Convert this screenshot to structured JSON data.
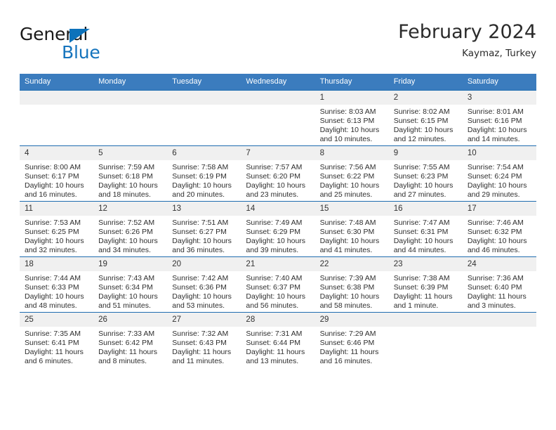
{
  "brand": {
    "name_dark": "General",
    "name_blue": "Blue",
    "accent_color": "#1574bd"
  },
  "header": {
    "title": "February 2024",
    "location": "Kaymaz, Turkey"
  },
  "theme": {
    "header_row_bg": "#3b7cbe",
    "cell_top_border": "#1f6cb0",
    "daynum_bg": "#f0f0f0"
  },
  "calendar": {
    "weekday_headers": [
      "Sunday",
      "Monday",
      "Tuesday",
      "Wednesday",
      "Thursday",
      "Friday",
      "Saturday"
    ],
    "weeks": [
      [
        {
          "day": "",
          "lines": []
        },
        {
          "day": "",
          "lines": []
        },
        {
          "day": "",
          "lines": []
        },
        {
          "day": "",
          "lines": []
        },
        {
          "day": "1",
          "lines": [
            "Sunrise: 8:03 AM",
            "Sunset: 6:13 PM",
            "Daylight: 10 hours",
            "and 10 minutes."
          ]
        },
        {
          "day": "2",
          "lines": [
            "Sunrise: 8:02 AM",
            "Sunset: 6:15 PM",
            "Daylight: 10 hours",
            "and 12 minutes."
          ]
        },
        {
          "day": "3",
          "lines": [
            "Sunrise: 8:01 AM",
            "Sunset: 6:16 PM",
            "Daylight: 10 hours",
            "and 14 minutes."
          ]
        }
      ],
      [
        {
          "day": "4",
          "lines": [
            "Sunrise: 8:00 AM",
            "Sunset: 6:17 PM",
            "Daylight: 10 hours",
            "and 16 minutes."
          ]
        },
        {
          "day": "5",
          "lines": [
            "Sunrise: 7:59 AM",
            "Sunset: 6:18 PM",
            "Daylight: 10 hours",
            "and 18 minutes."
          ]
        },
        {
          "day": "6",
          "lines": [
            "Sunrise: 7:58 AM",
            "Sunset: 6:19 PM",
            "Daylight: 10 hours",
            "and 20 minutes."
          ]
        },
        {
          "day": "7",
          "lines": [
            "Sunrise: 7:57 AM",
            "Sunset: 6:20 PM",
            "Daylight: 10 hours",
            "and 23 minutes."
          ]
        },
        {
          "day": "8",
          "lines": [
            "Sunrise: 7:56 AM",
            "Sunset: 6:22 PM",
            "Daylight: 10 hours",
            "and 25 minutes."
          ]
        },
        {
          "day": "9",
          "lines": [
            "Sunrise: 7:55 AM",
            "Sunset: 6:23 PM",
            "Daylight: 10 hours",
            "and 27 minutes."
          ]
        },
        {
          "day": "10",
          "lines": [
            "Sunrise: 7:54 AM",
            "Sunset: 6:24 PM",
            "Daylight: 10 hours",
            "and 29 minutes."
          ]
        }
      ],
      [
        {
          "day": "11",
          "lines": [
            "Sunrise: 7:53 AM",
            "Sunset: 6:25 PM",
            "Daylight: 10 hours",
            "and 32 minutes."
          ]
        },
        {
          "day": "12",
          "lines": [
            "Sunrise: 7:52 AM",
            "Sunset: 6:26 PM",
            "Daylight: 10 hours",
            "and 34 minutes."
          ]
        },
        {
          "day": "13",
          "lines": [
            "Sunrise: 7:51 AM",
            "Sunset: 6:27 PM",
            "Daylight: 10 hours",
            "and 36 minutes."
          ]
        },
        {
          "day": "14",
          "lines": [
            "Sunrise: 7:49 AM",
            "Sunset: 6:29 PM",
            "Daylight: 10 hours",
            "and 39 minutes."
          ]
        },
        {
          "day": "15",
          "lines": [
            "Sunrise: 7:48 AM",
            "Sunset: 6:30 PM",
            "Daylight: 10 hours",
            "and 41 minutes."
          ]
        },
        {
          "day": "16",
          "lines": [
            "Sunrise: 7:47 AM",
            "Sunset: 6:31 PM",
            "Daylight: 10 hours",
            "and 44 minutes."
          ]
        },
        {
          "day": "17",
          "lines": [
            "Sunrise: 7:46 AM",
            "Sunset: 6:32 PM",
            "Daylight: 10 hours",
            "and 46 minutes."
          ]
        }
      ],
      [
        {
          "day": "18",
          "lines": [
            "Sunrise: 7:44 AM",
            "Sunset: 6:33 PM",
            "Daylight: 10 hours",
            "and 48 minutes."
          ]
        },
        {
          "day": "19",
          "lines": [
            "Sunrise: 7:43 AM",
            "Sunset: 6:34 PM",
            "Daylight: 10 hours",
            "and 51 minutes."
          ]
        },
        {
          "day": "20",
          "lines": [
            "Sunrise: 7:42 AM",
            "Sunset: 6:36 PM",
            "Daylight: 10 hours",
            "and 53 minutes."
          ]
        },
        {
          "day": "21",
          "lines": [
            "Sunrise: 7:40 AM",
            "Sunset: 6:37 PM",
            "Daylight: 10 hours",
            "and 56 minutes."
          ]
        },
        {
          "day": "22",
          "lines": [
            "Sunrise: 7:39 AM",
            "Sunset: 6:38 PM",
            "Daylight: 10 hours",
            "and 58 minutes."
          ]
        },
        {
          "day": "23",
          "lines": [
            "Sunrise: 7:38 AM",
            "Sunset: 6:39 PM",
            "Daylight: 11 hours",
            "and 1 minute."
          ]
        },
        {
          "day": "24",
          "lines": [
            "Sunrise: 7:36 AM",
            "Sunset: 6:40 PM",
            "Daylight: 11 hours",
            "and 3 minutes."
          ]
        }
      ],
      [
        {
          "day": "25",
          "lines": [
            "Sunrise: 7:35 AM",
            "Sunset: 6:41 PM",
            "Daylight: 11 hours",
            "and 6 minutes."
          ]
        },
        {
          "day": "26",
          "lines": [
            "Sunrise: 7:33 AM",
            "Sunset: 6:42 PM",
            "Daylight: 11 hours",
            "and 8 minutes."
          ]
        },
        {
          "day": "27",
          "lines": [
            "Sunrise: 7:32 AM",
            "Sunset: 6:43 PM",
            "Daylight: 11 hours",
            "and 11 minutes."
          ]
        },
        {
          "day": "28",
          "lines": [
            "Sunrise: 7:31 AM",
            "Sunset: 6:44 PM",
            "Daylight: 11 hours",
            "and 13 minutes."
          ]
        },
        {
          "day": "29",
          "lines": [
            "Sunrise: 7:29 AM",
            "Sunset: 6:46 PM",
            "Daylight: 11 hours",
            "and 16 minutes."
          ]
        },
        {
          "day": "",
          "lines": []
        },
        {
          "day": "",
          "lines": []
        }
      ]
    ]
  }
}
